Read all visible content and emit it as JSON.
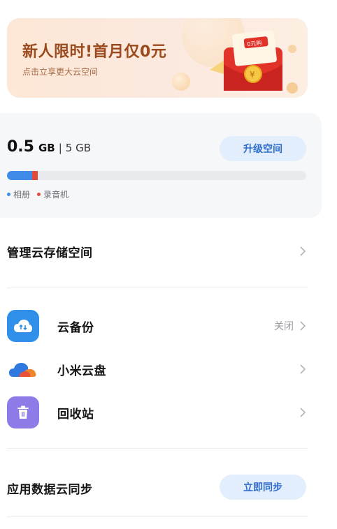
{
  "promo": {
    "title": "新人限时!首月仅0元",
    "subtitle": "点击立享更大云空间",
    "coupon_text": "0元购"
  },
  "storage": {
    "used_value": "0.5",
    "used_unit": "GB",
    "separator": "|",
    "total": "5 GB",
    "upgrade_label": "升级空间",
    "usage_fraction_album": 0.084,
    "usage_fraction_recorder": 0.019,
    "legend": [
      {
        "label": "相册",
        "color": "#3e8ce8"
      },
      {
        "label": "录音机",
        "color": "#e04b3c"
      }
    ]
  },
  "manage": {
    "title": "管理云存储空间"
  },
  "services": [
    {
      "label": "云备份",
      "status": "关闭",
      "icon": "cloud-backup-icon"
    },
    {
      "label": "小米云盘",
      "status": "",
      "icon": "xiaomi-cloud-drive-icon"
    },
    {
      "label": "回收站",
      "status": "",
      "icon": "trash-icon"
    }
  ],
  "sync": {
    "title": "应用数据云同步",
    "button_label": "立即同步"
  },
  "colors": {
    "accent": "#2f6dcc",
    "accent_bg": "#e2eefc",
    "promo_text": "#9a4a1c"
  }
}
